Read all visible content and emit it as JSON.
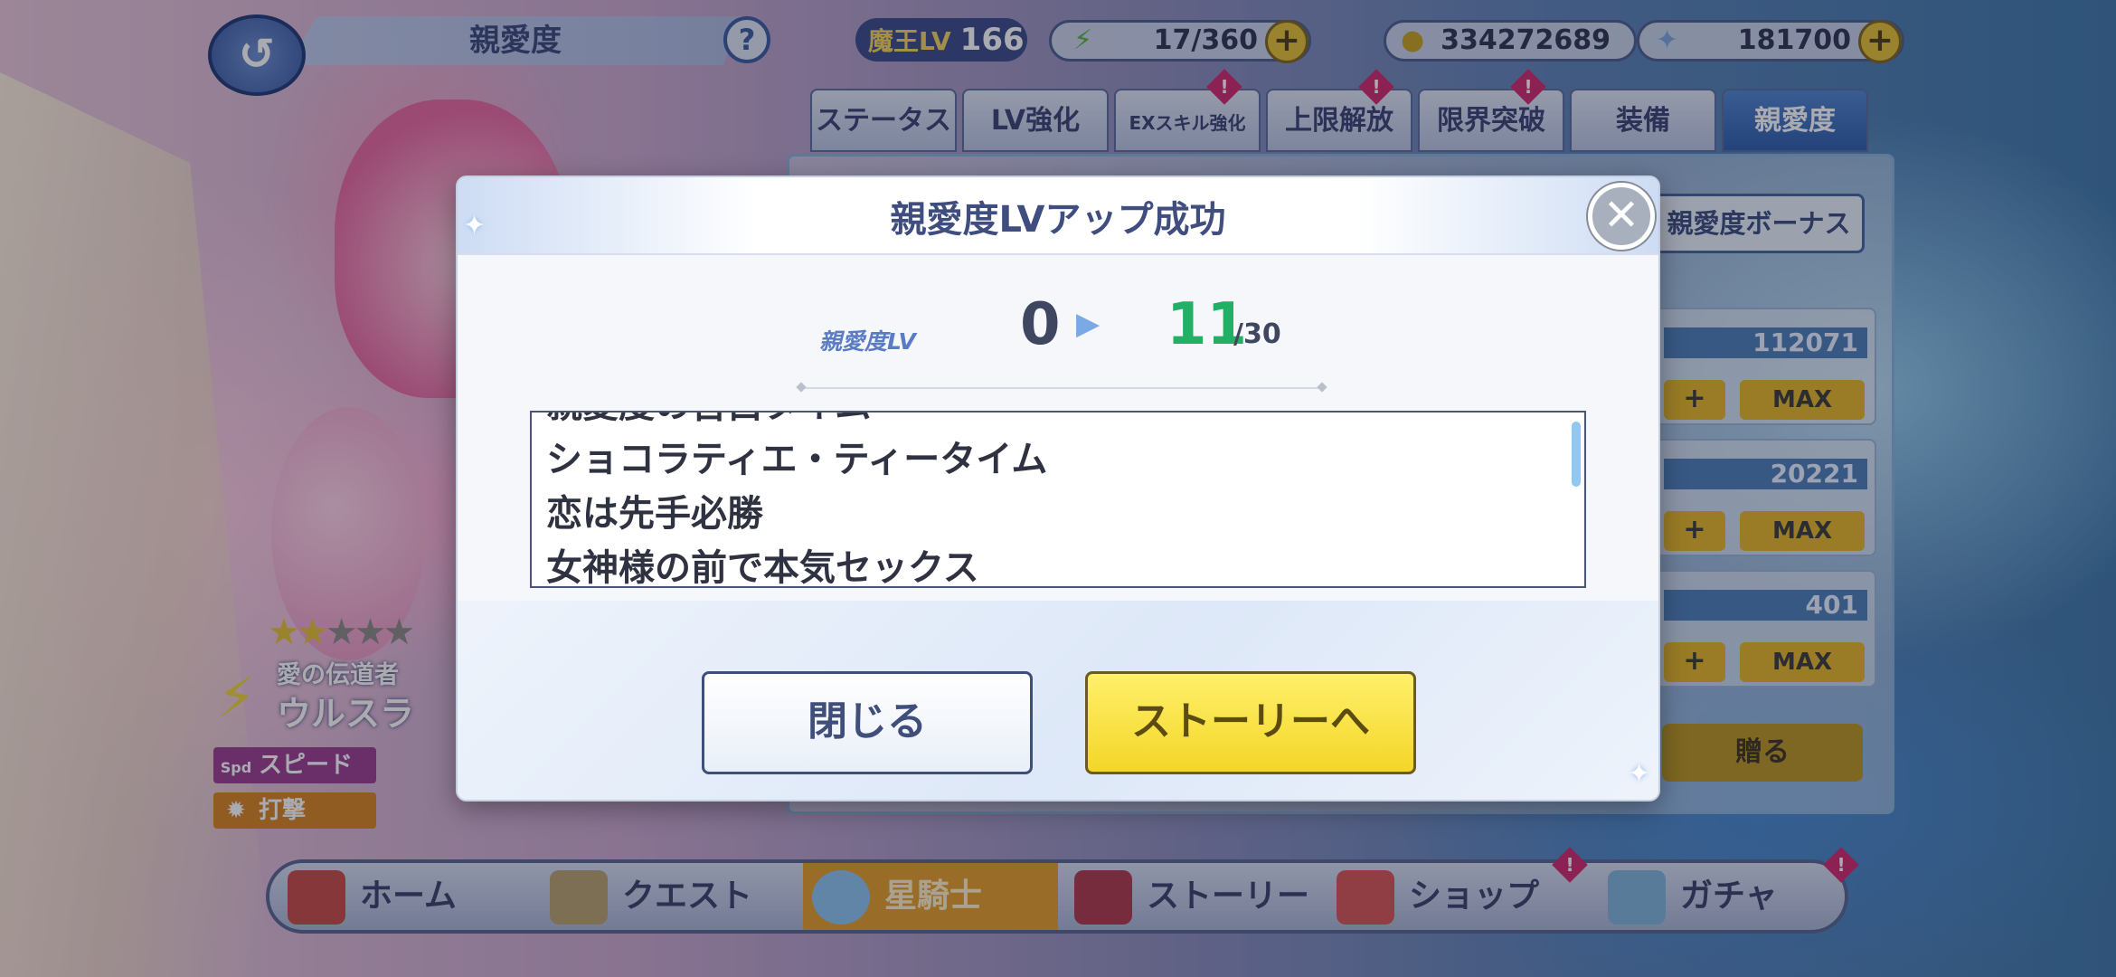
{
  "header": {
    "title": "親愛度",
    "help_label": "?",
    "player_level_label": "魔王LV",
    "player_level_value": "166",
    "stamina": "17/360",
    "gold": "334272689",
    "gems": "181700"
  },
  "tabs": [
    {
      "label": "ステータス",
      "badge": ""
    },
    {
      "label": "LV強化",
      "badge": ""
    },
    {
      "label": "EXスキル強化",
      "badge": "!"
    },
    {
      "label": "上限解放",
      "badge": "!"
    },
    {
      "label": "限界突破",
      "badge": "!"
    },
    {
      "label": "装備",
      "badge": ""
    },
    {
      "label": "親愛度",
      "badge": ""
    }
  ],
  "background_panel": {
    "bonus_label": "親愛度ボーナス",
    "rows": [
      {
        "value": "112071",
        "plus": "+",
        "max": "MAX"
      },
      {
        "value": "20221",
        "plus": "+",
        "max": "MAX"
      },
      {
        "value": "401",
        "plus": "+",
        "max": "MAX"
      }
    ],
    "gift_label": "贈る"
  },
  "character": {
    "stars_filled": 2,
    "stars_total": 5,
    "job": "愛の伝道者",
    "name": "ウルスラ",
    "traits": [
      {
        "icon": "Spd",
        "label": "スピード"
      },
      {
        "icon": "✹",
        "label": "打撃"
      }
    ]
  },
  "modal": {
    "title": "親愛度LVアップ成功",
    "close_symbol": "✕",
    "level_label": "親愛度LV",
    "level_from": "0",
    "arrow": "▶",
    "level_to": "11",
    "level_max": "/30",
    "unlocked_items": [
      "親愛度の告白タイム",
      "ショコラティエ・ティータイム",
      "恋は先手必勝",
      "女神様の前で本気セックス"
    ],
    "close_button": "閉じる",
    "story_button": "ストーリーへ"
  },
  "nav": [
    {
      "label": "ホーム",
      "active": false,
      "badge": ""
    },
    {
      "label": "クエスト",
      "active": false,
      "badge": ""
    },
    {
      "label": "星騎士",
      "active": true,
      "badge": ""
    },
    {
      "label": "ストーリー",
      "active": false,
      "badge": ""
    },
    {
      "label": "ショップ",
      "active": false,
      "badge": "!"
    },
    {
      "label": "ガチャ",
      "active": false,
      "badge": "!"
    }
  ],
  "colors": {
    "level_to": "#22b066",
    "story_button": "#f3d628",
    "active_tab": "#2d5ea9",
    "nav_active": "#e5a02a"
  }
}
